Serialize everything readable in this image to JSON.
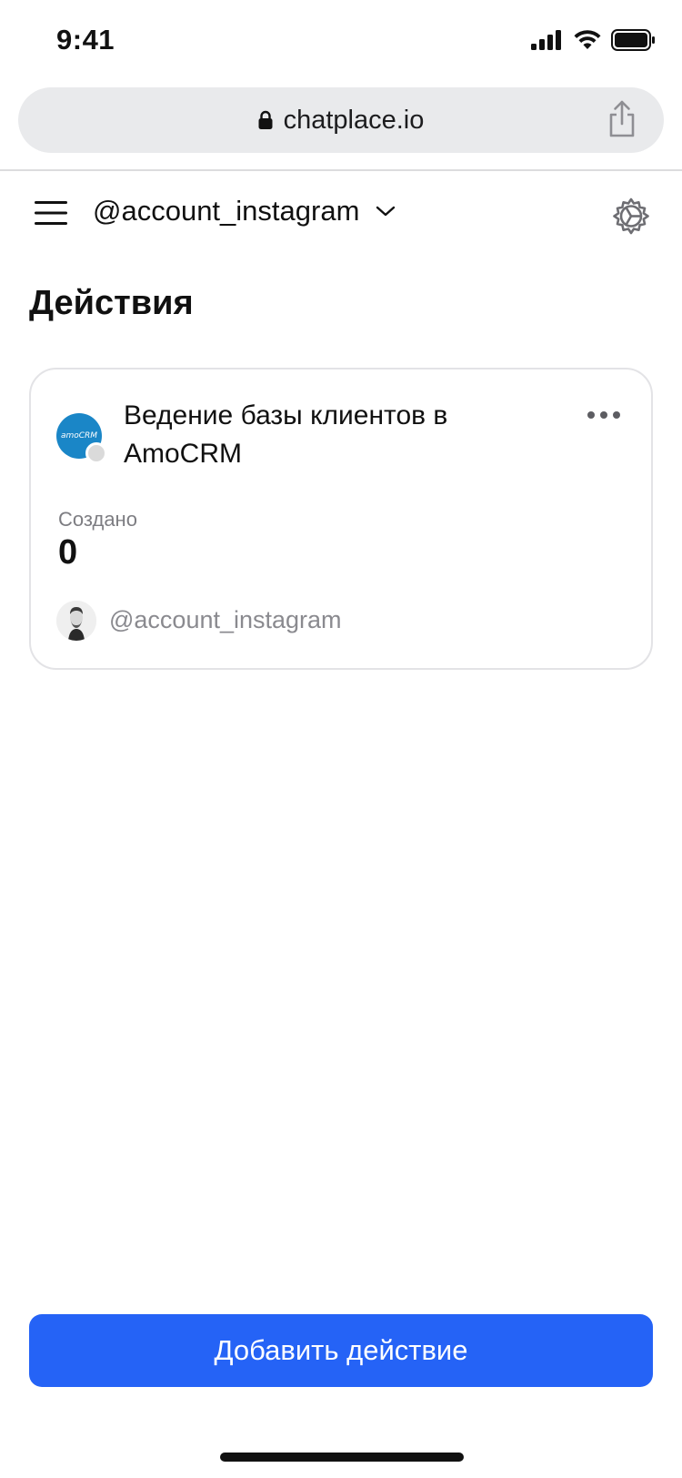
{
  "status_bar": {
    "time": "9:41"
  },
  "browser": {
    "url": "chatplace.io"
  },
  "header": {
    "account": "@account_instagram"
  },
  "page": {
    "title": "Действия"
  },
  "actions": [
    {
      "title": "Ведение базы клиентов в AmoCRM",
      "logo_text": "amoCRM",
      "stat_label": "Создано",
      "stat_value": "0",
      "owner": "@account_instagram"
    }
  ],
  "footer": {
    "add_button_label": "Добавить действие"
  },
  "colors": {
    "accent": "#2563f6",
    "logo_blue": "#1a86c7"
  }
}
